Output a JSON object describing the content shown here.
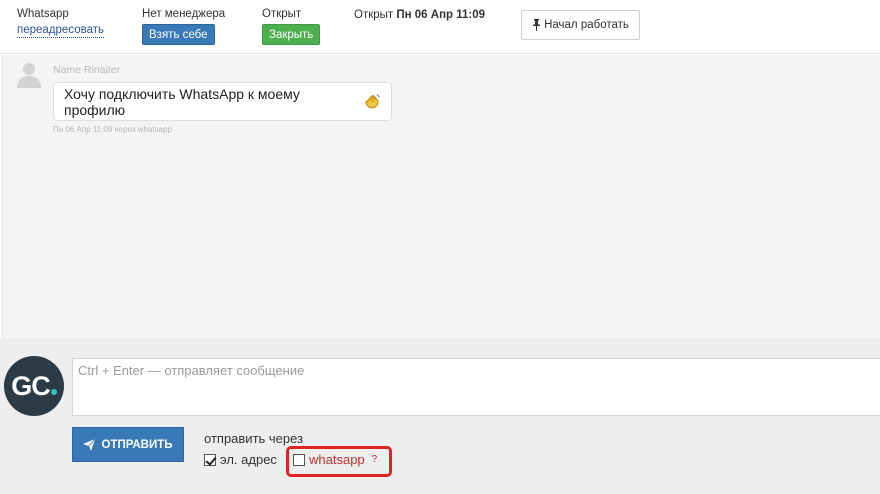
{
  "header": {
    "channel_label": "Whatsapp",
    "redirect_link": "переадресовать",
    "manager_label": "Нет менеджера",
    "take_button": "Взять себе",
    "status_label": "Открыт",
    "close_button": "Закрыть",
    "opened_prefix": "Открыт",
    "opened_datetime": "Пн 06 Апр 11:09",
    "start_work_button": "Начал работать"
  },
  "chat": {
    "messages": [
      {
        "author": "Name Rinaiter",
        "text": "Хочу подключить WhatsApp к моему профилю",
        "meta": "Пн 06 Апр 11:09 через whatsapp"
      }
    ]
  },
  "composer": {
    "placeholder": "Ctrl + Enter — отправляет сообщение",
    "send_button": "ОТПРАВИТЬ",
    "send_via_label": "отправить через",
    "options": [
      {
        "label": "эл. адрес",
        "checked": true
      },
      {
        "label": "whatsapp",
        "checked": false,
        "help": "?"
      }
    ]
  },
  "colors": {
    "primary": "#3a79b7",
    "success": "#4cb04f",
    "highlight": "#e02424",
    "avatar_bg": "#2b3b47",
    "avatar_accent": "#2fc5b8"
  }
}
